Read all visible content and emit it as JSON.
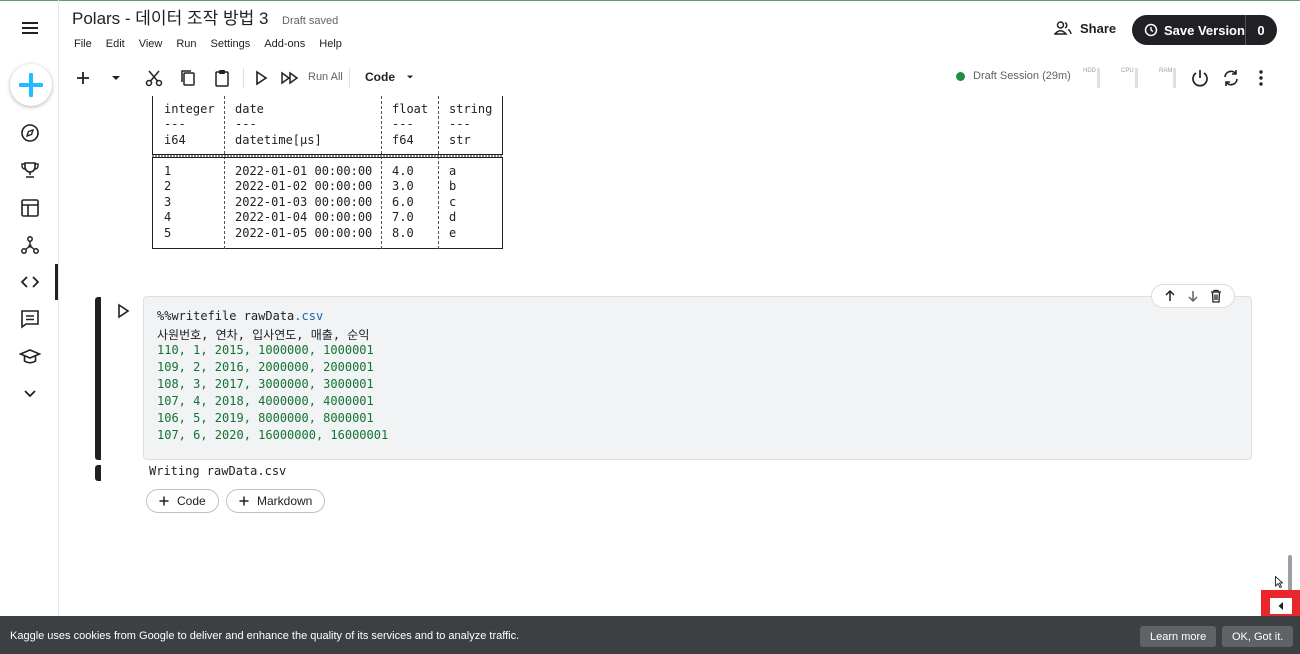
{
  "app": {
    "title": "Polars - 데이터 조작 방법 3",
    "draft_status": "Draft saved"
  },
  "menubar": [
    "File",
    "Edit",
    "View",
    "Run",
    "Settings",
    "Add-ons",
    "Help"
  ],
  "header": {
    "share_label": "Share",
    "save_version_label": "Save Version",
    "save_version_count": "0"
  },
  "toolbar": {
    "run_all_label": "Run All",
    "cell_type": "Code",
    "session_label": "Draft Session (29m)",
    "meters": [
      "HDD",
      "CPU",
      "RAM"
    ]
  },
  "output_table": {
    "columns": [
      {
        "name": "integer",
        "sep": "---",
        "dtype": "i64"
      },
      {
        "name": "date",
        "sep": "---",
        "dtype": "datetime[μs]"
      },
      {
        "name": "float",
        "sep": "---",
        "dtype": "f64"
      },
      {
        "name": "string",
        "sep": "---",
        "dtype": "str"
      }
    ],
    "rows": [
      [
        "1",
        "2022-01-01 00:00:00",
        "4.0",
        "a"
      ],
      [
        "2",
        "2022-01-02 00:00:00",
        "3.0",
        "b"
      ],
      [
        "3",
        "2022-01-03 00:00:00",
        "6.0",
        "c"
      ],
      [
        "4",
        "2022-01-04 00:00:00",
        "7.0",
        "d"
      ],
      [
        "5",
        "2022-01-05 00:00:00",
        "8.0",
        "e"
      ]
    ]
  },
  "code_cell": {
    "magic": "%%writefile rawData",
    "ext": ".csv",
    "header_line": "사원번호, 연차, 입사연도, 매출, 순익",
    "data_lines": [
      "110, 1, 2015, 1000000, 1000001",
      "109, 2, 2016, 2000000, 2000001",
      "108, 3, 2017, 3000000, 3000001",
      "107, 4, 2018, 4000000, 4000001",
      "106, 5, 2019, 8000000, 8000001",
      "107, 6, 2020, 16000000, 16000001"
    ],
    "output": "Writing rawData.csv"
  },
  "add_buttons": {
    "code": "Code",
    "markdown": "Markdown"
  },
  "cookie": {
    "message": "Kaggle uses cookies from Google to deliver and enhance the quality of its services and to analyze traffic.",
    "learn_more": "Learn more",
    "ok": "OK, Got it."
  },
  "colors": {
    "accent": "#20beff",
    "session_dot": "#1e8e3e",
    "highlight": "#e8262b"
  }
}
